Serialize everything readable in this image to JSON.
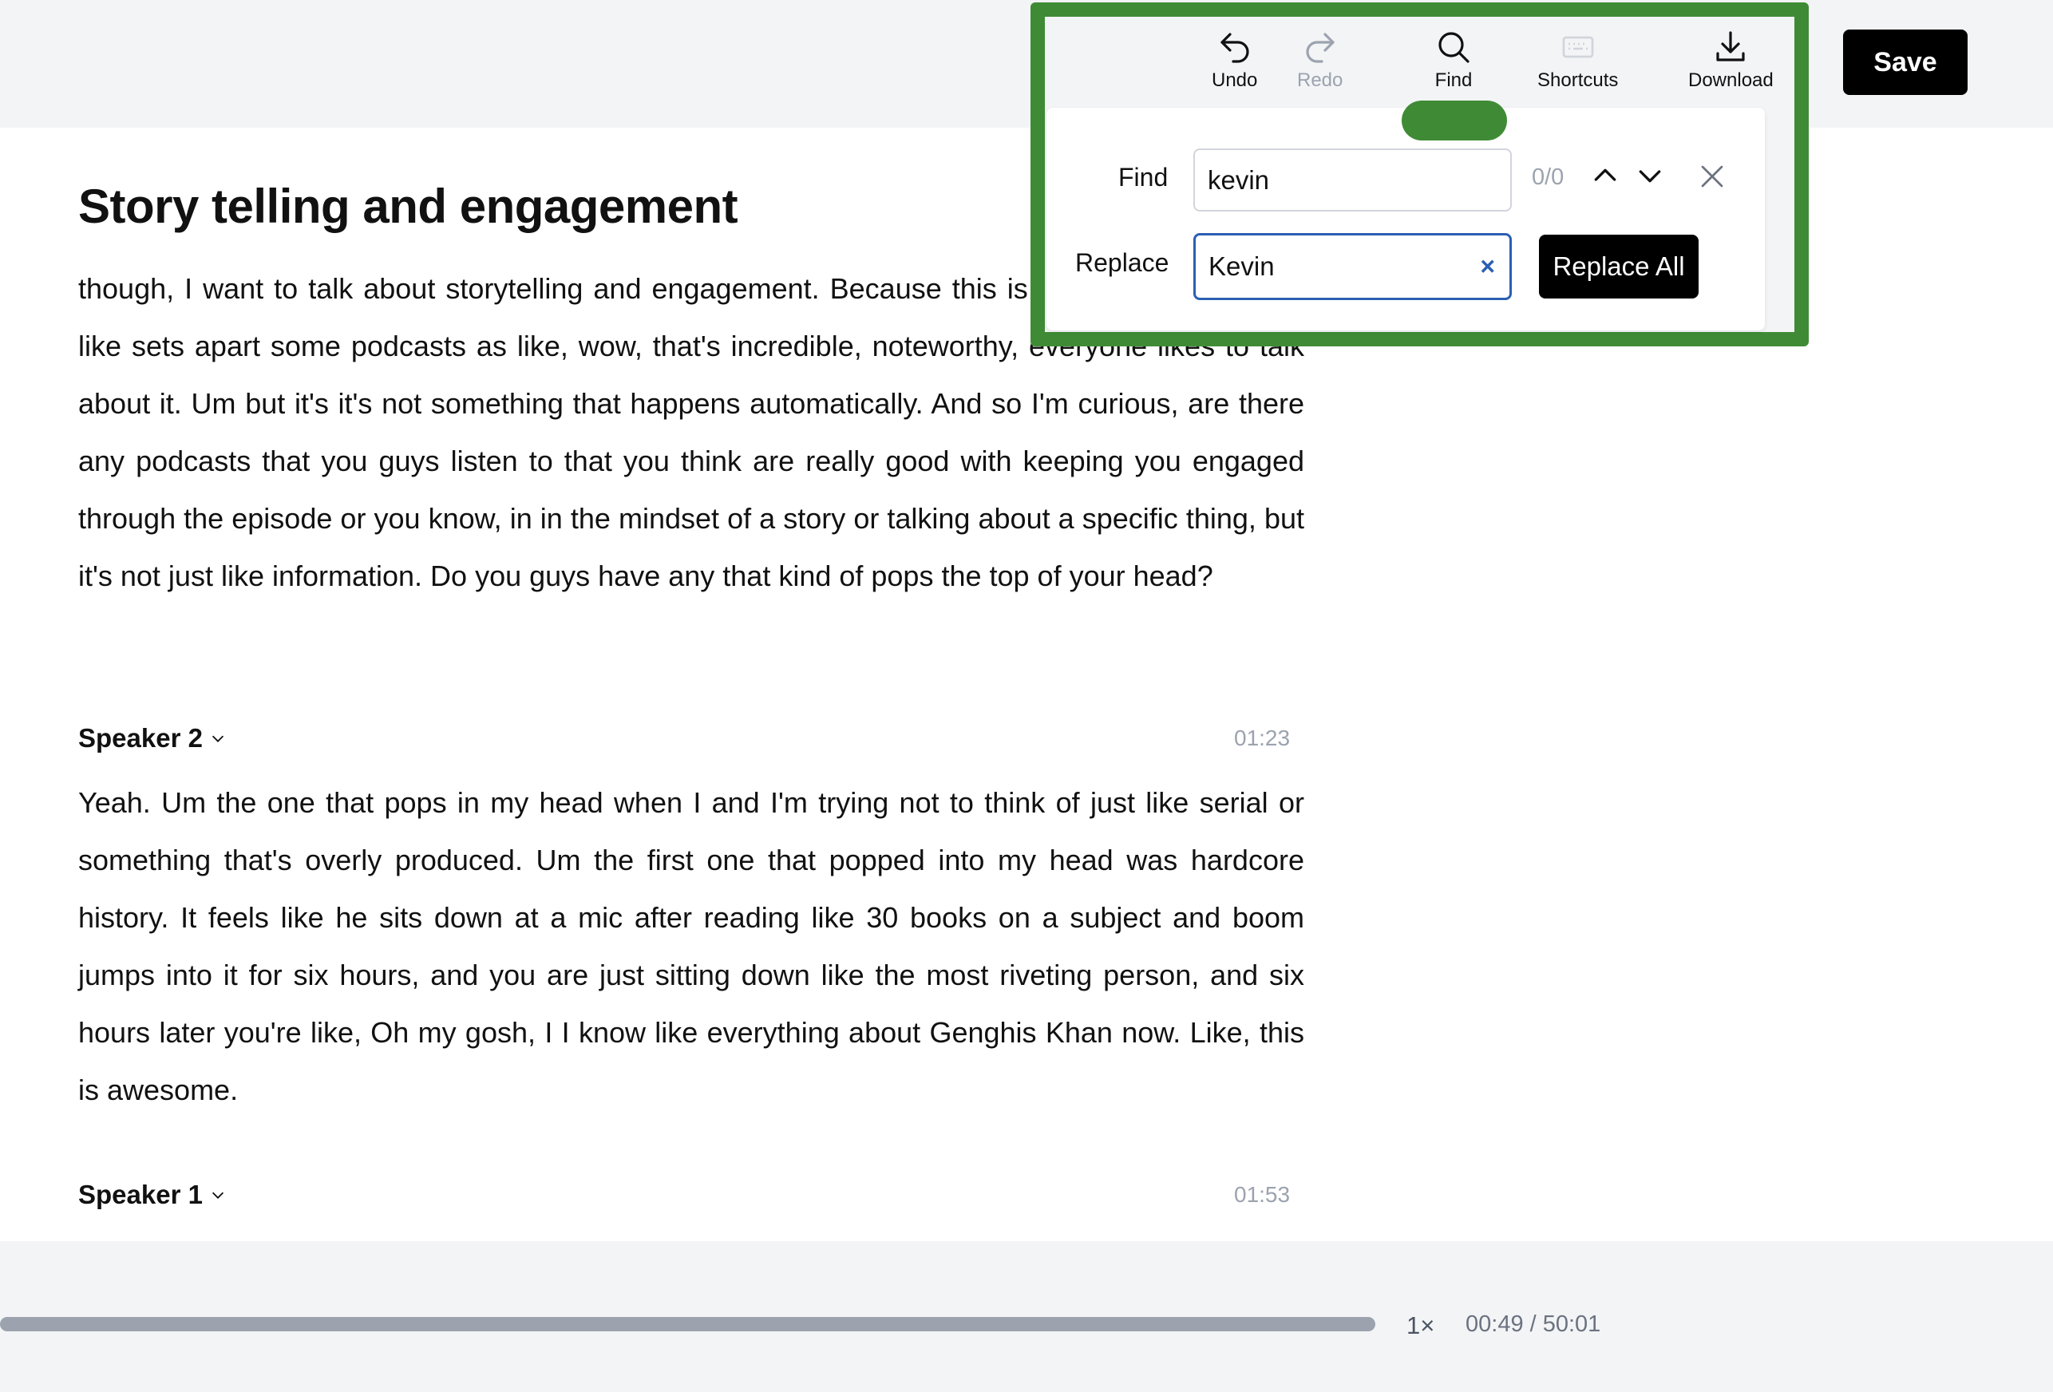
{
  "toolbar": {
    "undo_label": "Undo",
    "redo_label": "Redo",
    "find_label": "Find",
    "shortcuts_label": "Shortcuts",
    "download_label": "Download",
    "save_label": "Save",
    "highlight_color": "#3f8b35"
  },
  "find_replace": {
    "find_label": "Find",
    "find_value": "kevin",
    "replace_label": "Replace",
    "replace_value": "Kevin",
    "clear_icon": "×",
    "match_count": "0/0",
    "replace_all_label": "Replace All",
    "focus_color": "#2b5fb3"
  },
  "document": {
    "title": "Story telling and engagement",
    "intro_text": "though, I want to talk about storytelling and engagement. Because this is something that I feel like sets apart some podcasts as like, wow, that's incredible, noteworthy, everyone likes to talk about it. Um but it's it's not something that happens automatically. And so I'm curious, are there any podcasts that you guys listen to that you think are really good with keeping you engaged through the episode or you know, in in the mindset of a story or talking about a specific thing, but it's not just like information. Do you guys have any that kind of pops the top of your head?",
    "segments": [
      {
        "speaker": "Speaker 2",
        "timestamp": "01:23",
        "text": "Yeah. Um the one that pops in my head when I and I'm trying not to think of just like serial or something that's overly produced. Um the first one that popped into my head was hardcore history. It feels like he sits down at a mic after reading like 30 books on a subject and boom jumps into it for six hours, and you are just sitting down like the most riveting person, and six hours later you're like, Oh my gosh, I I know like everything about Genghis Khan now. Like, this is awesome."
      },
      {
        "speaker": "Speaker 1",
        "timestamp": "01:53"
      }
    ]
  },
  "player": {
    "speed": "1×",
    "time": "00:49 / 50:01",
    "progress_fraction": 0.016
  }
}
